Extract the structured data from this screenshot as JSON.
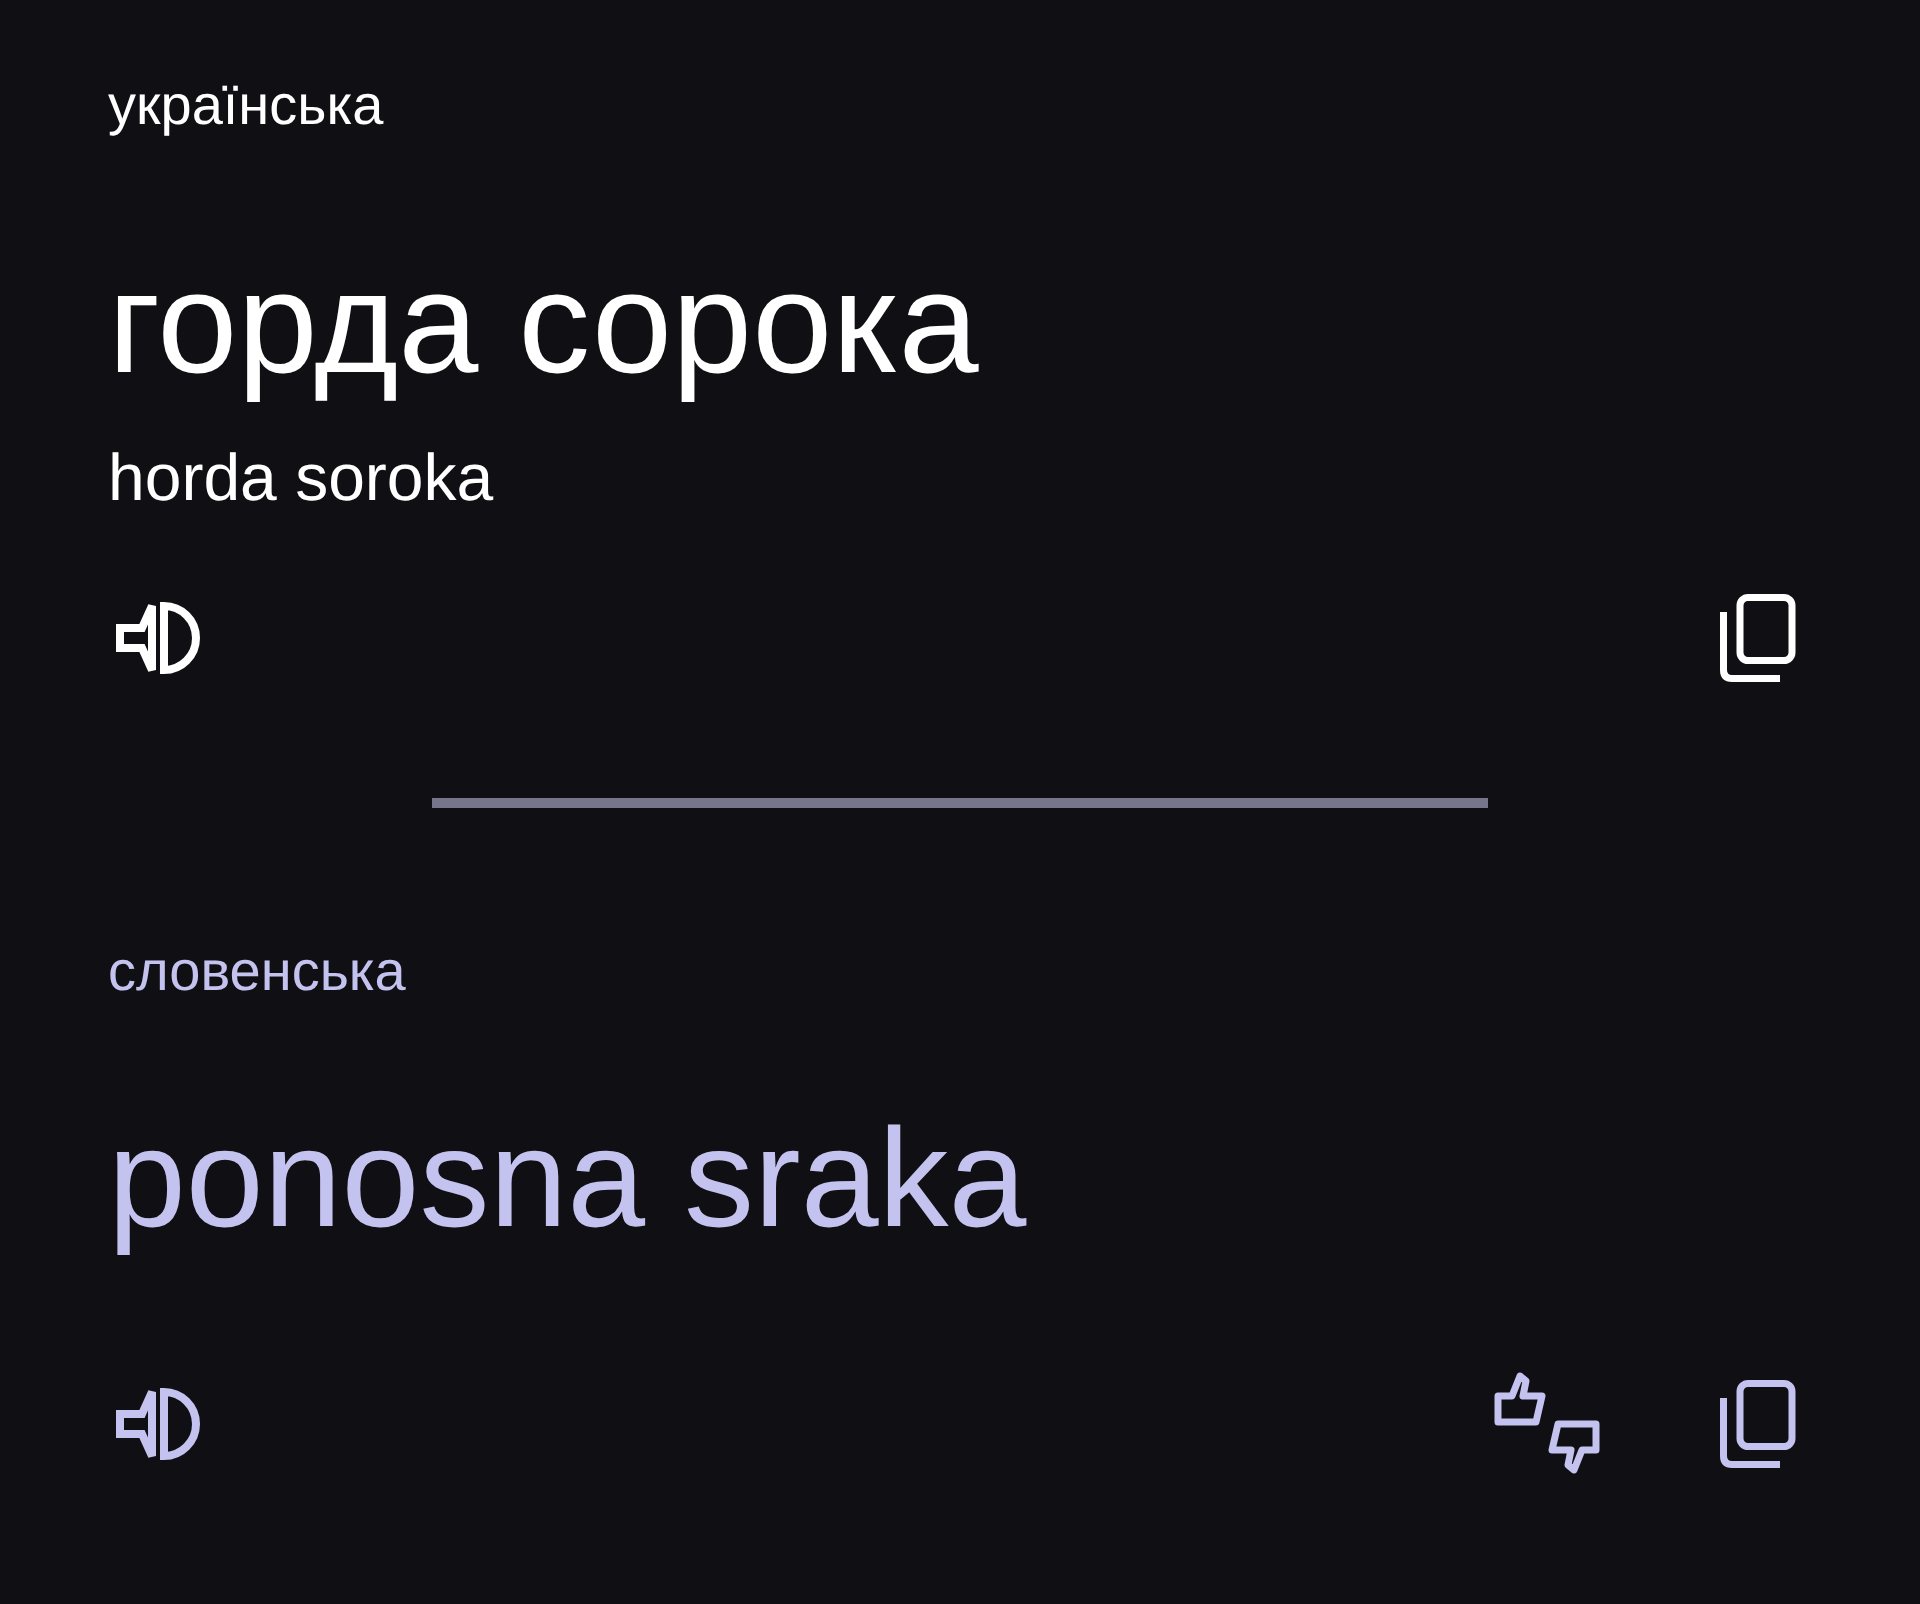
{
  "source": {
    "language": "українська",
    "text": "горда сорока",
    "transliteration": "horda soroka"
  },
  "target": {
    "language": "словенська",
    "text": "ponosna sraka"
  }
}
